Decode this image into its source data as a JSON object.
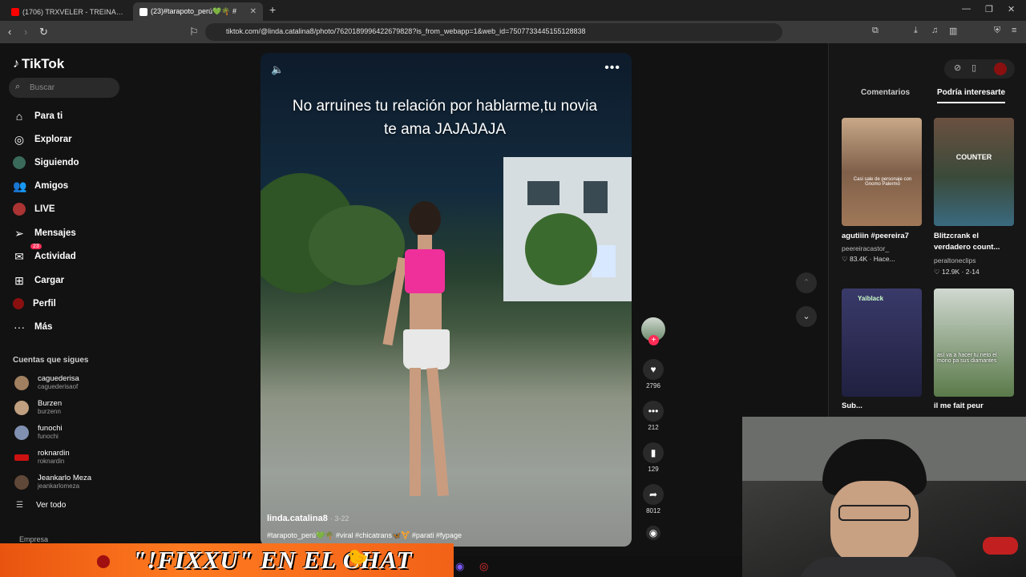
{
  "browser": {
    "tabs": [
      {
        "label": "(1706) TRXVELER - TREINAMENTO",
        "favicon_color": "#ff0000"
      },
      {
        "label": "(23)#tarapoto_perú💚🌴 #",
        "favicon_color": "#ffffff"
      }
    ],
    "url": "tiktok.com/@linda.catalina8/photo/7620189996422679828?is_from_webapp=1&web_id=7507733445155128838"
  },
  "sidebar": {
    "logo": "TikTok",
    "search_placeholder": "Buscar",
    "nav": [
      {
        "label": "Para ti",
        "icon": "home-icon"
      },
      {
        "label": "Explorar",
        "icon": "compass-icon"
      },
      {
        "label": "Siguiendo",
        "icon": "following-avatar-icon"
      },
      {
        "label": "Amigos",
        "icon": "friends-icon"
      },
      {
        "label": "LIVE",
        "icon": "live-icon"
      },
      {
        "label": "Mensajes",
        "icon": "paper-plane-icon"
      },
      {
        "label": "Actividad",
        "icon": "activity-icon",
        "badge": "23"
      },
      {
        "label": "Cargar",
        "icon": "upload-icon"
      },
      {
        "label": "Perfil",
        "icon": "profile-icon"
      },
      {
        "label": "Más",
        "icon": "more-icon"
      }
    ],
    "following_title": "Cuentas que sigues",
    "accounts": [
      {
        "name": "caguederisa",
        "handle": "caguederisaof",
        "color": "#a08060"
      },
      {
        "name": "Burzen",
        "handle": "burzenn",
        "color": "#c0a080"
      },
      {
        "name": "funochi",
        "handle": "funochi",
        "color": "#8090b0"
      },
      {
        "name": "roknardin",
        "handle": "roknardin",
        "color": "#cc1111"
      },
      {
        "name": "Jeankarlo Meza",
        "handle": "jeankarlomeza",
        "color": "#604838"
      }
    ],
    "see_all": "Ver todo",
    "footer": "Empresa"
  },
  "video": {
    "caption": "No arruines tu relación por hablarme,tu novia te ama JAJAJAJA",
    "username": "linda.catalina8",
    "date": "· 3-22",
    "hashtags": "#tarapoto_perú💚🌴 #viral #chicatrans🦋⚧️ #parati #fypage"
  },
  "actions": {
    "likes": "2796",
    "comments": "212",
    "saves": "129",
    "shares": "8012"
  },
  "right_panel": {
    "tabs": [
      "Comentarios",
      "Podría interesarte"
    ],
    "active_tab": "Podría interesarte",
    "cards": [
      {
        "title": "agutiiin #peereira7",
        "user": "peereiracastor_",
        "stats": "♡ 83.4K · Hace...",
        "overlay": "Casi sale de personaje con Gnomo Palermo"
      },
      {
        "title": "Blitzcrank el verdadero count...",
        "user": "peraltoneclips",
        "stats": "♡ 12.9K · 2-14",
        "overlay": "COUNTER"
      },
      {
        "title": "Sub...",
        "user": "",
        "stats": "",
        "overlay": "Yaiblack"
      },
      {
        "title": "il me fait peur",
        "user": "",
        "stats": "",
        "overlay": "así va a hacer tu neto el mono pa sus diamantes"
      }
    ]
  },
  "stream_overlay": {
    "banner_text": "\"!FIXXU\" EN EL CHAT"
  }
}
